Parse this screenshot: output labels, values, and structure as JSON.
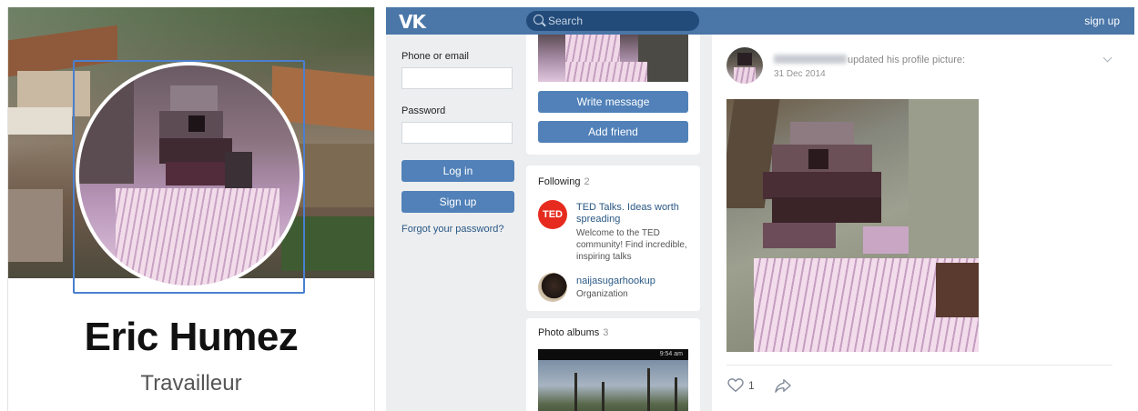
{
  "profile": {
    "name": "Eric Humez",
    "subtitle": "Travailleur"
  },
  "vk": {
    "logo": "VK",
    "search_placeholder": "Search",
    "signup_link": "sign up",
    "login": {
      "phone_label": "Phone or email",
      "password_label": "Password",
      "login_button": "Log in",
      "signup_button": "Sign up",
      "forgot_link": "Forgot your password?"
    },
    "profile_actions": {
      "write_message": "Write message",
      "add_friend": "Add friend"
    },
    "following": {
      "title": "Following",
      "count": "2",
      "items": [
        {
          "logo_text": "TED",
          "name": "TED Talks. Ideas worth spreading",
          "description": "Welcome to the TED community! Find incredible, inspiring talks"
        },
        {
          "name": "naijasugarhookup",
          "description": "Organization"
        }
      ]
    },
    "albums": {
      "title": "Photo albums",
      "count": "3",
      "thumb_time": "9:54 am"
    },
    "post": {
      "action": "updated his profile picture:",
      "date": "31 Dec 2014",
      "likes": "1"
    },
    "colors": {
      "header": "#4a76a8",
      "button": "#5181b8",
      "link": "#2a5885",
      "background": "#edeef0"
    }
  }
}
